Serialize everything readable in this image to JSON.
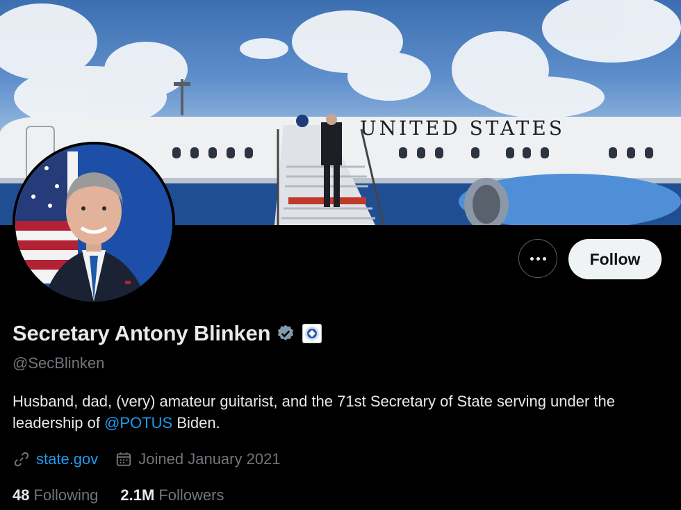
{
  "profile": {
    "display_name": "Secretary Antony Blinken",
    "handle": "@SecBlinken",
    "bio_part1": "Husband, dad, (very) amateur guitarist, and the 71st Secretary of State serving under the leadership of ",
    "bio_mention": "@POTUS",
    "bio_part2": " Biden.",
    "website": "state.gov",
    "joined": "Joined January 2021",
    "following_count": "48",
    "following_label": "Following",
    "followers_count": "2.1M",
    "followers_label": "Followers"
  },
  "banner": {
    "aircraft_text": "UNITED STATES"
  },
  "actions": {
    "follow_label": "Follow"
  },
  "icons": {
    "more": "more-dots-icon",
    "verified": "verified-badge-icon",
    "affiliate": "government-seal-icon",
    "link": "link-icon",
    "calendar": "calendar-icon"
  },
  "colors": {
    "accent": "#1d9bf0",
    "background": "#000000",
    "secondary_text": "#71767b",
    "verified_badge": "#829aab"
  }
}
